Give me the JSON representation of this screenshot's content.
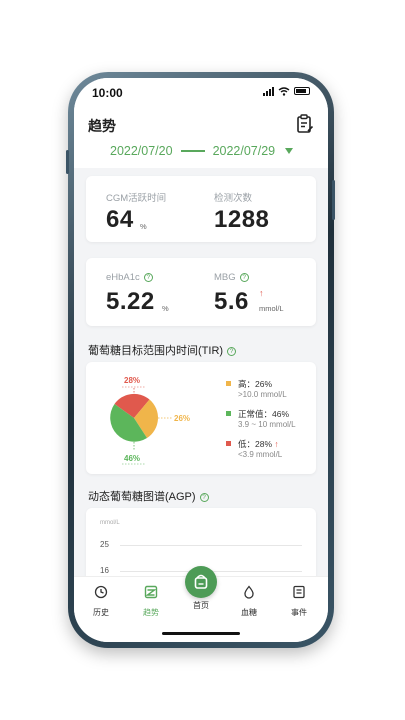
{
  "status_bar": {
    "time": "10:00"
  },
  "header": {
    "title": "趋势",
    "date_start": "2022/07/20",
    "date_end": "2022/07/29"
  },
  "cgm_card": {
    "active_label": "CGM活跃时间",
    "active_value": "64",
    "active_unit": "%",
    "count_label": "检测次数",
    "count_value": "1288"
  },
  "glucose_card": {
    "hba1c_label": "eHbA1c",
    "hba1c_value": "5.22",
    "hba1c_unit": "%",
    "mbg_label": "MBG",
    "mbg_value": "5.6",
    "mbg_unit": "mmol/L",
    "mbg_trend": "↑"
  },
  "tir": {
    "title": "葡萄糖目标范围内时间(TIR)",
    "pie_labels": {
      "high": "28%",
      "normal": "46%",
      "low": "26%"
    },
    "legend": [
      {
        "main": "高：26%",
        "sub": ">10.0 mmol/L",
        "color": "#f0b54a"
      },
      {
        "main": "正常值：46%",
        "sub": "3.9 ~ 10 mmol/L",
        "color": "#5cb65b"
      },
      {
        "main": "低：28%",
        "trend": "↑",
        "sub": "<3.9 mmol/L",
        "color": "#e0594d"
      }
    ]
  },
  "agp": {
    "title": "动态葡萄糖图谱(AGP)",
    "unit_label": "mmol/L",
    "ticks": [
      "25",
      "16"
    ]
  },
  "tabbar": {
    "items": [
      {
        "label": "历史",
        "icon": "clock-icon"
      },
      {
        "label": "趋势",
        "icon": "trend-icon"
      },
      {
        "label": "首页",
        "icon": "home-sensor-icon"
      },
      {
        "label": "血糖",
        "icon": "drop-icon"
      },
      {
        "label": "事件",
        "icon": "list-icon"
      }
    ]
  },
  "colors": {
    "accent": "#59a85c",
    "high": "#f0b54a",
    "normal": "#5cb65b",
    "low": "#e0594d"
  }
}
